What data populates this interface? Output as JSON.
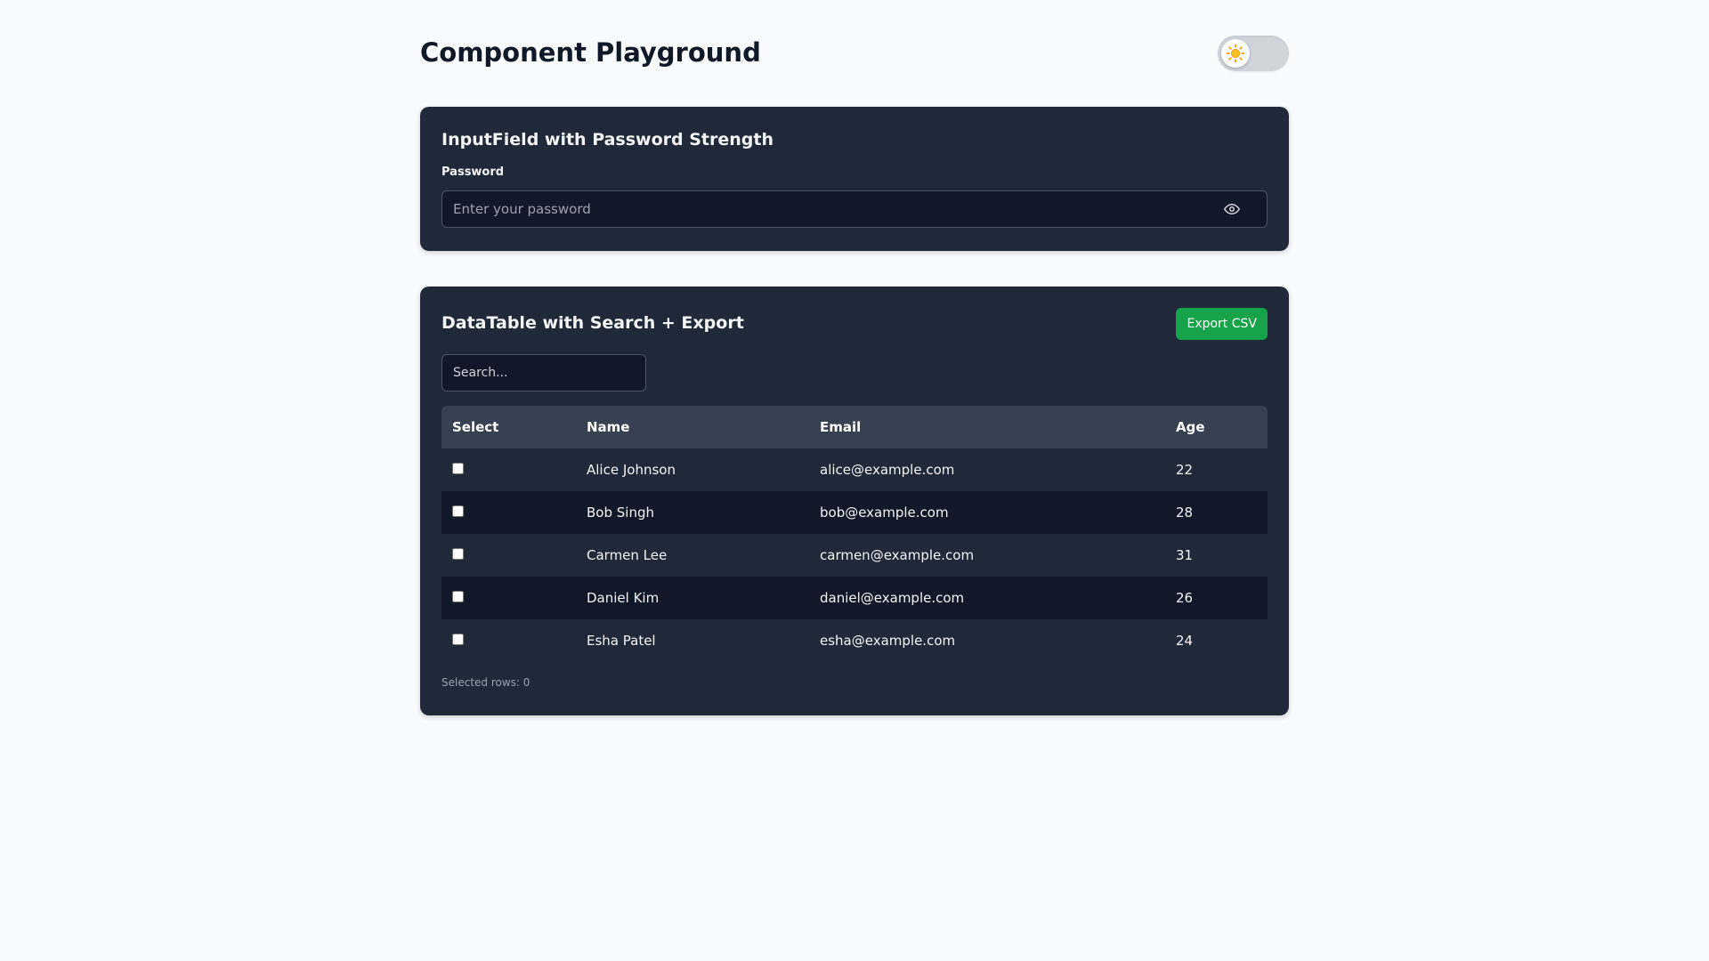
{
  "page": {
    "title": "Component Playground",
    "theme_toggle": {
      "icon": "sun-icon",
      "knob_color": "#ffffff",
      "icon_color": "#f59e0b"
    }
  },
  "password_card": {
    "title": "InputField with Password Strength",
    "label": "Password",
    "placeholder": "Enter your password",
    "value": "",
    "toggle_icon": "eye-icon"
  },
  "table_card": {
    "title": "DataTable with Search + Export",
    "export_label": "Export CSV",
    "search_placeholder": "Search...",
    "search_value": "",
    "columns": [
      "Select",
      "Name",
      "Email",
      "Age"
    ],
    "rows": [
      {
        "name": "Alice Johnson",
        "email": "alice@example.com",
        "age": "22",
        "selected": false
      },
      {
        "name": "Bob Singh",
        "email": "bob@example.com",
        "age": "28",
        "selected": false
      },
      {
        "name": "Carmen Lee",
        "email": "carmen@example.com",
        "age": "31",
        "selected": false
      },
      {
        "name": "Daniel Kim",
        "email": "daniel@example.com",
        "age": "26",
        "selected": false
      },
      {
        "name": "Esha Patel",
        "email": "esha@example.com",
        "age": "24",
        "selected": false
      }
    ],
    "selected_text": "Selected rows: 0"
  },
  "colors": {
    "page_bg": "#f8fafc",
    "card_bg": "#1f2937",
    "input_bg": "#111827",
    "header_row_bg": "#374151",
    "accent_green": "#16a34a"
  }
}
